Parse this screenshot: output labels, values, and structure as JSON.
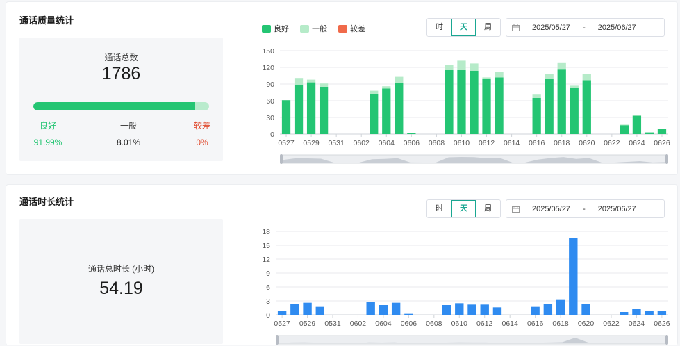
{
  "quality": {
    "title": "通话质量统计",
    "total_label": "通话总数",
    "total_value": "1786",
    "good_fraction": 0.9199,
    "categories": [
      {
        "label": "良好",
        "pct": "91.99%",
        "color": "#24c573"
      },
      {
        "label": "一般",
        "pct": "8.01%",
        "color": "#222222"
      },
      {
        "label": "较差",
        "pct": "0%",
        "color": "#e0492d"
      }
    ],
    "legend": [
      {
        "label": "良好",
        "color": "#24c573"
      },
      {
        "label": "一般",
        "color": "#b6ebc9"
      },
      {
        "label": "较差",
        "color": "#f06a4a"
      }
    ],
    "granularity": [
      "时",
      "天",
      "周"
    ],
    "active_granularity": "天",
    "date_start": "2025/05/27",
    "date_sep": "-",
    "date_end": "2025/06/27"
  },
  "duration": {
    "title": "通话时长统计",
    "total_label": "通话总时长 (小时)",
    "total_value": "54.19",
    "granularity": [
      "时",
      "天",
      "周"
    ],
    "active_granularity": "天",
    "date_start": "2025/05/27",
    "date_sep": "-",
    "date_end": "2025/06/27"
  },
  "chart_data": [
    {
      "type": "bar",
      "stacked": true,
      "x": [
        "0527",
        "0528",
        "0529",
        "0530",
        "0531",
        "0601",
        "0602",
        "0603",
        "0604",
        "0605",
        "0606",
        "0607",
        "0608",
        "0609",
        "0610",
        "0611",
        "0612",
        "0613",
        "0614",
        "0615",
        "0616",
        "0617",
        "0618",
        "0619",
        "0620",
        "0621",
        "0622",
        "0623",
        "0624",
        "0625",
        "0626"
      ],
      "xticks": [
        "0527",
        "0529",
        "0531",
        "0602",
        "0604",
        "0606",
        "0608",
        "0610",
        "0612",
        "0614",
        "0616",
        "0618",
        "0620",
        "0622",
        "0624",
        "0626"
      ],
      "yticks": [
        0,
        30,
        60,
        90,
        120,
        150
      ],
      "ylim": [
        0,
        150
      ],
      "series": [
        {
          "name": "良好",
          "color": "#24c573",
          "values": [
            61,
            89,
            93,
            85,
            0,
            0,
            0,
            72,
            82,
            92,
            2,
            0,
            0,
            115,
            115,
            114,
            100,
            102,
            0,
            0,
            65,
            100,
            116,
            83,
            97,
            0,
            0,
            16,
            33,
            3,
            10
          ]
        },
        {
          "name": "一般",
          "color": "#b6ebc9",
          "values": [
            0,
            12,
            5,
            6,
            0,
            0,
            0,
            6,
            4,
            11,
            0,
            0,
            0,
            9,
            17,
            13,
            2,
            10,
            0,
            0,
            6,
            8,
            13,
            4,
            11,
            0,
            0,
            1,
            1,
            0,
            0
          ]
        },
        {
          "name": "较差",
          "color": "#f06a4a",
          "values": [
            0,
            0,
            0,
            0,
            0,
            0,
            0,
            0,
            0,
            0,
            0,
            0,
            0,
            0,
            0,
            0,
            0,
            0,
            0,
            0,
            0,
            0,
            0,
            0,
            0,
            0,
            0,
            0,
            0,
            0,
            0
          ]
        }
      ],
      "grid": true
    },
    {
      "type": "bar",
      "x": [
        "0527",
        "0528",
        "0529",
        "0530",
        "0531",
        "0601",
        "0602",
        "0603",
        "0604",
        "0605",
        "0606",
        "0607",
        "0608",
        "0609",
        "0610",
        "0611",
        "0612",
        "0613",
        "0614",
        "0615",
        "0616",
        "0617",
        "0618",
        "0619",
        "0620",
        "0621",
        "0622",
        "0623",
        "0624",
        "0625",
        "0626"
      ],
      "xticks": [
        "0527",
        "0529",
        "0531",
        "0602",
        "0604",
        "0606",
        "0608",
        "0610",
        "0612",
        "0614",
        "0616",
        "0618",
        "0620",
        "0622",
        "0624",
        "0626"
      ],
      "yticks": [
        0,
        3,
        6,
        9,
        12,
        15,
        18
      ],
      "ylim": [
        0,
        18
      ],
      "series": [
        {
          "color": "#2f8bf0",
          "values": [
            0.9,
            2.4,
            2.6,
            1.7,
            0,
            0,
            0,
            2.7,
            2.1,
            2.6,
            0.2,
            0,
            0,
            2.1,
            2.5,
            2.2,
            2.2,
            1.6,
            0,
            0,
            1.7,
            2.3,
            3.2,
            16.5,
            2.4,
            0,
            0,
            0.6,
            1.2,
            0.9,
            0.9
          ]
        }
      ],
      "grid": true
    }
  ]
}
